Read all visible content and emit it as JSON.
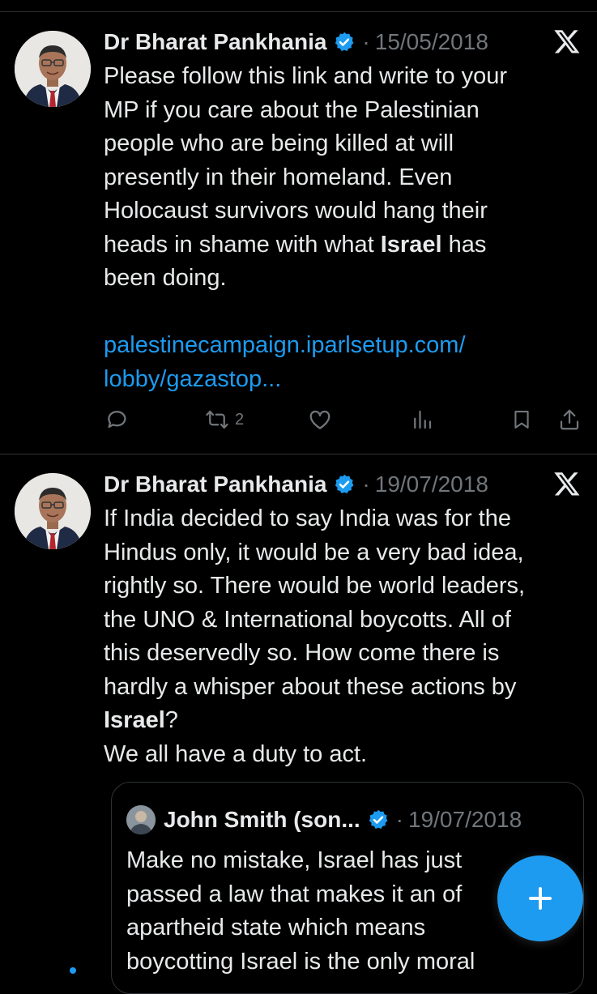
{
  "tweets": [
    {
      "author": "Dr Bharat Pankhania",
      "separator": "·",
      "date": "15/05/2018",
      "text_lines": [
        "Please follow this link and write to your",
        "MP if you care about the Palestinian",
        "people who are being killed at will",
        "presently in their homeland. Even",
        "Holocaust survivors  would hang their"
      ],
      "line6_before": "heads in shame with what ",
      "line6_bold": "Israel",
      "line6_after": " has",
      "line7": "been doing.",
      "link_line1": "palestinecampaign.iparlsetup.com/",
      "link_line2": "lobby/gazastop...",
      "actions": {
        "reply_icon": "reply-icon",
        "retweet_icon": "retweet-icon",
        "retweet_count": "2",
        "like_icon": "like-icon",
        "views_icon": "views-icon",
        "bookmark_icon": "bookmark-icon",
        "share_icon": "share-icon"
      }
    },
    {
      "author": "Dr Bharat Pankhania",
      "separator": "·",
      "date": "19/07/2018",
      "text_lines": [
        "If India decided to say India was for the",
        "Hindus only, it would be a very bad idea,",
        "rightly so. There would be world leaders,",
        "the UNO & International boycotts. All of",
        "this deservedly so. How come there is",
        "hardly a whisper about these actions by"
      ],
      "line7_bold": "Israel",
      "line7_after": "?",
      "line8": "We all have a duty to act.",
      "quote": {
        "author": "John Smith (son...",
        "separator": "·",
        "date": "19/07/2018",
        "text_lines": [
          "Make no mistake, Israel has just",
          "passed a law that makes it an of",
          "apartheid state which means",
          "boycotting Israel is the only moral"
        ]
      }
    }
  ],
  "fab": {
    "icon": "plus-icon",
    "label": "+"
  },
  "colors": {
    "background": "#000000",
    "text": "#e7e9ea",
    "muted": "#71767b",
    "accent": "#1d9bf0",
    "divider": "#2f3336"
  }
}
